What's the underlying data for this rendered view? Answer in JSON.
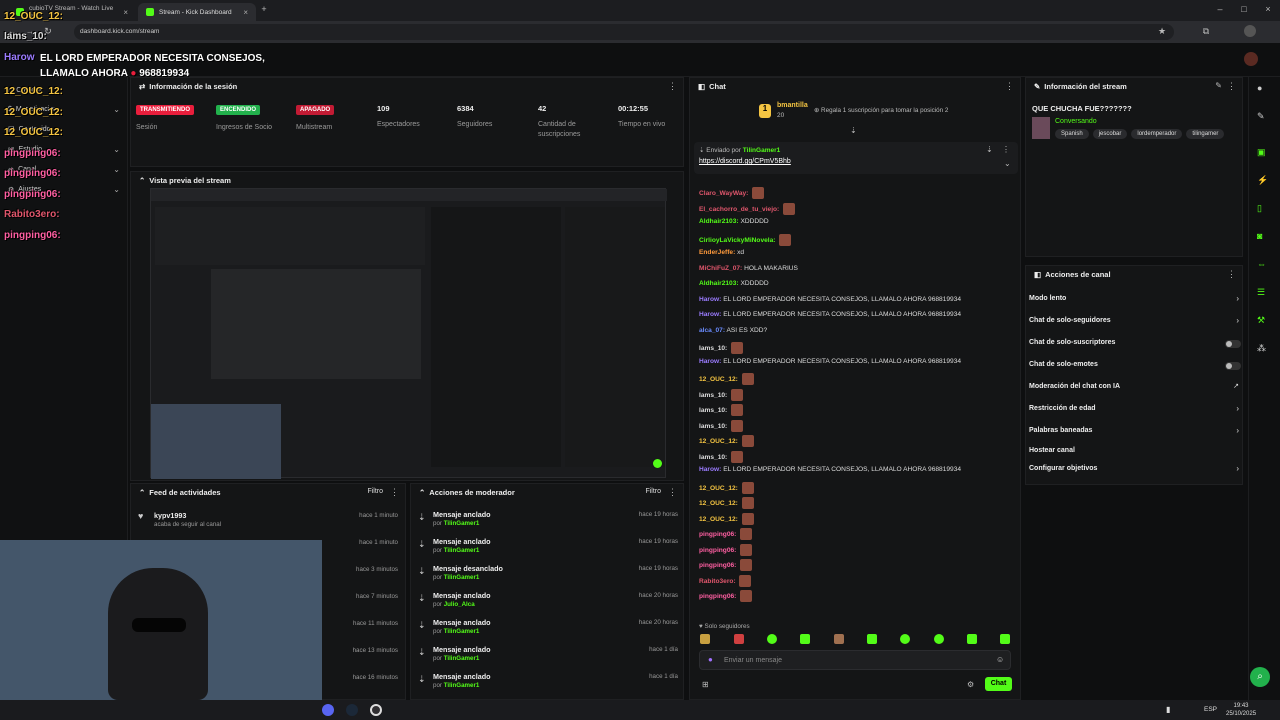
{
  "browser": {
    "tabs": [
      {
        "label": "cubioTV Stream - Watch Live o"
      },
      {
        "label": "Stream - Kick Dashboard"
      }
    ],
    "url": "dashboard.kick.com/stream"
  },
  "stream_title": "EL LORD EMPERADOR NECESITA CONSEJOS, LLAMALO AHORA",
  "stream_phone": "968819934",
  "overlay_names": [
    "12_OUC_12:",
    "Iams_10:",
    "Harow",
    "12_OUC_12:",
    "12_OUC_12:",
    "12_OUC_12:",
    "pingping06:",
    "pingping06:",
    "pingping06:",
    "Rabito3ero:",
    "pingping06:"
  ],
  "sidebar": {
    "items": [
      {
        "label": "Creador"
      },
      {
        "label": "Monetizacion"
      },
      {
        "label": "Contenido"
      },
      {
        "label": "Estudio"
      },
      {
        "label": "Canal"
      },
      {
        "label": "Ajustes"
      }
    ]
  },
  "session": {
    "title": "Información de la sesión",
    "stats": [
      {
        "badge": "TRANSMITIENDO",
        "label": "Sesión",
        "color": "#e91e3c"
      },
      {
        "badge": "ENCENDIDO",
        "label": "Ingresos de Socio",
        "color": "#22b14c"
      },
      {
        "badge": "APAGADO",
        "label": "Multistream",
        "color": "#c21b34"
      },
      {
        "value": "109",
        "label": "Espectadores"
      },
      {
        "value": "6384",
        "label": "Seguidores"
      },
      {
        "value": "42",
        "label": "Cantidad de suscripciones"
      },
      {
        "value": "00:12:55",
        "label": "Tiempo en vivo"
      }
    ]
  },
  "preview": {
    "title": "Vista previa del stream"
  },
  "activity": {
    "title": "Feed de actividades",
    "filter": "Filtro",
    "rows": [
      {
        "user": "kypv1993",
        "action": "acaba de seguir al canal",
        "time": "hace 1 minuto"
      },
      {
        "user": "",
        "action": "",
        "time": "hace 1 minuto"
      },
      {
        "user": "",
        "action": "",
        "time": "hace 3 minutos"
      },
      {
        "user": "",
        "action": "",
        "time": "hace 7 minutos"
      },
      {
        "user": "",
        "action": "",
        "time": "hace 11 minutos"
      },
      {
        "user": "",
        "action": "",
        "time": "hace 13 minutos"
      },
      {
        "user": "",
        "action": "",
        "time": "hace 16 minutos"
      }
    ]
  },
  "mod_actions": {
    "title": "Acciones de moderador",
    "filter": "Filtro",
    "rows": [
      {
        "action": "Mensaje anclado",
        "by": "por",
        "user": "TilinGamer1",
        "time": "hace 19 horas"
      },
      {
        "action": "Mensaje anclado",
        "by": "por",
        "user": "TilinGamer1",
        "time": "hace 19 horas"
      },
      {
        "action": "Mensaje desanclado",
        "by": "por",
        "user": "TilinGamer1",
        "time": "hace 19 horas"
      },
      {
        "action": "Mensaje anclado",
        "by": "por",
        "user": "Julio_Alca",
        "time": "hace 20 horas"
      },
      {
        "action": "Mensaje anclado",
        "by": "por",
        "user": "TilinGamer1",
        "time": "hace 20 horas"
      },
      {
        "action": "Mensaje anclado",
        "by": "por",
        "user": "TilinGamer1",
        "time": "hace 1 día"
      },
      {
        "action": "Mensaje anclado",
        "by": "por",
        "user": "TilinGamer1",
        "time": "hace 1 día"
      }
    ]
  },
  "chat": {
    "title": "Chat",
    "gifter": "bmantilla",
    "gift_count": "20",
    "gift_text": "Regala 1 suscripción para tomar la posición 2",
    "pinned_by_label": "Enviado por",
    "pinned_by": "TilinGamer1",
    "pinned_link": "https://discord.gg/CPmV5Bhb",
    "messages": [
      {
        "user": "Claro_WayWay:",
        "text": "",
        "color": "#e0566c"
      },
      {
        "user": "El_cachorro_de_tu_viejo:",
        "text": "",
        "color": "#e0566c"
      },
      {
        "user": "Aldhair2103:",
        "text": "XDDDDD",
        "color": "#53fc18"
      },
      {
        "user": "CirlioyLaVickyMiNovela:",
        "text": "",
        "color": "#53fc18"
      },
      {
        "user": "EnderJeffe:",
        "text": "xd",
        "color": "#ff9a3c"
      },
      {
        "user": "MiChiFuZ_07:",
        "text": "HOLA MAKARIUS",
        "color": "#e0566c"
      },
      {
        "user": "Aldhair2103:",
        "text": "XDDDDD",
        "color": "#53fc18"
      },
      {
        "user": "Harow:",
        "text": "EL LORD EMPERADOR NECESITA CONSEJOS, LLAMALO AHORA  968819934",
        "color": "#9b7cff"
      },
      {
        "user": "Harow:",
        "text": "EL LORD EMPERADOR NECESITA CONSEJOS, LLAMALO AHORA  968819934",
        "color": "#9b7cff"
      },
      {
        "user": "alca_07:",
        "text": "ASI ES XDD?",
        "color": "#6a8cff"
      },
      {
        "user": "Iams_10:",
        "text": "",
        "color": "#dddddd"
      },
      {
        "user": "Harow:",
        "text": "EL LORD EMPERADOR NECESITA CONSEJOS, LLAMALO AHORA  968819934",
        "color": "#9b7cff"
      },
      {
        "user": "12_OUC_12:",
        "text": "",
        "color": "#f5c542"
      },
      {
        "user": "Iams_10:",
        "text": "",
        "color": "#dddddd"
      },
      {
        "user": "Iams_10:",
        "text": "",
        "color": "#dddddd"
      },
      {
        "user": "Iams_10:",
        "text": "",
        "color": "#dddddd"
      },
      {
        "user": "12_OUC_12:",
        "text": "",
        "color": "#f5c542"
      },
      {
        "user": "Iams_10:",
        "text": "",
        "color": "#dddddd"
      },
      {
        "user": "Harow:",
        "text": "EL LORD EMPERADOR NECESITA CONSEJOS, LLAMALO AHORA  968819934",
        "color": "#9b7cff"
      },
      {
        "user": "12_OUC_12:",
        "text": "",
        "color": "#f5c542"
      },
      {
        "user": "12_OUC_12:",
        "text": "",
        "color": "#f5c542"
      },
      {
        "user": "12_OUC_12:",
        "text": "",
        "color": "#f5c542"
      },
      {
        "user": "pingping06:",
        "text": "",
        "color": "#ff5fa2"
      },
      {
        "user": "pingping06:",
        "text": "",
        "color": "#ff5fa2"
      },
      {
        "user": "pingping06:",
        "text": "",
        "color": "#ff5fa2"
      },
      {
        "user": "Rabito3ero:",
        "text": "",
        "color": "#e0566c"
      },
      {
        "user": "pingping06:",
        "text": "",
        "color": "#ff5fa2"
      }
    ],
    "followers_only": "Solo seguidores",
    "input_placeholder": "Enviar un mensaje",
    "send_label": "Chat"
  },
  "stream_info": {
    "title": "Información del stream",
    "stream_title": "QUE CHUCHA FUE???????",
    "category": "Conversando",
    "tags": [
      "Spanish",
      "jescobar",
      "lordemperador",
      "tilingamer"
    ]
  },
  "channel_actions": {
    "title": "Acciones de canal",
    "items": [
      {
        "label": "Modo lento",
        "control": "chevron"
      },
      {
        "label": "Chat de solo-seguidores",
        "control": "chevron"
      },
      {
        "label": "Chat de solo-suscriptores",
        "control": "toggle"
      },
      {
        "label": "Chat de solo-emotes",
        "control": "toggle"
      },
      {
        "label": "Moderación del chat con IA",
        "control": "external"
      },
      {
        "label": "Restricción de edad",
        "control": "chevron"
      },
      {
        "label": "Palabras baneadas",
        "control": "chevron"
      },
      {
        "label": "Hostear canal",
        "control": "none"
      },
      {
        "label": "Configurar objetivos",
        "control": "chevron"
      }
    ]
  },
  "taskbar": {
    "lang": "ESP",
    "time": "19:43",
    "date": "25/10/2025"
  },
  "colors": {
    "accent": "#53fc18",
    "live": "#e91e3c"
  }
}
